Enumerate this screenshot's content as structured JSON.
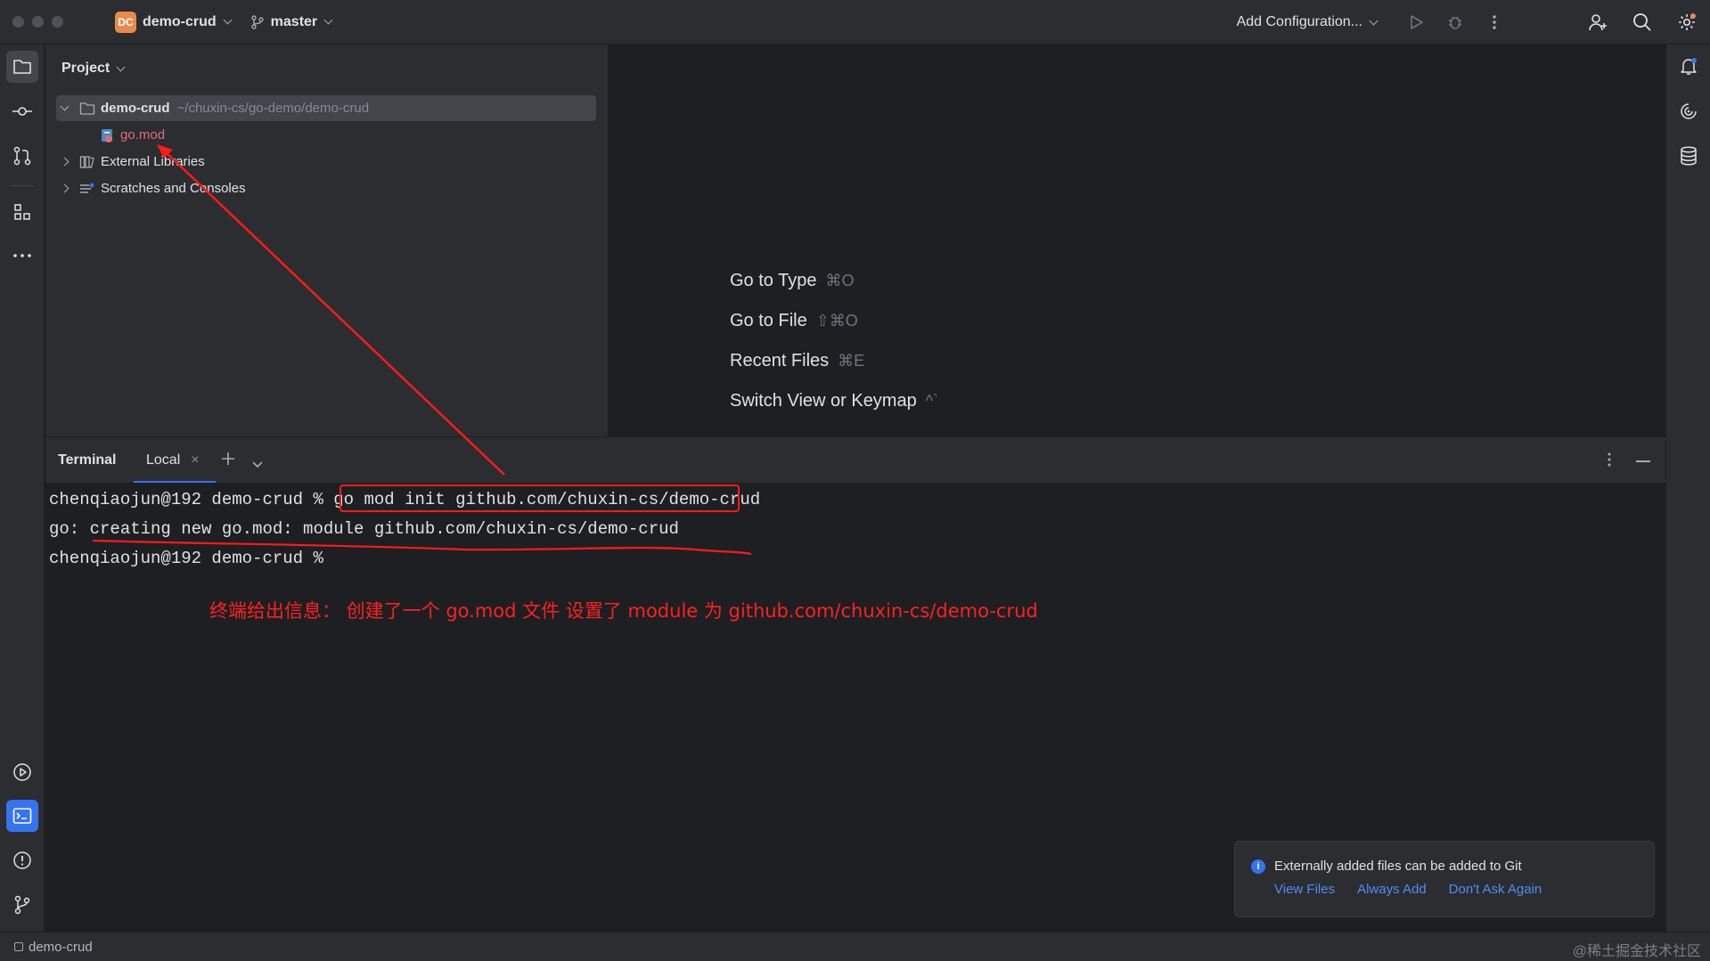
{
  "titlebar": {
    "project_badge": "DC",
    "project_name": "demo-crud",
    "branch": "master",
    "run_config": "Add Configuration..."
  },
  "project_panel": {
    "title": "Project",
    "tree": [
      {
        "name": "demo-crud",
        "path": "~/chuxin-cs/go-demo/demo-crud"
      },
      {
        "name": "go.mod"
      },
      {
        "name": "External Libraries"
      },
      {
        "name": "Scratches and Consoles"
      }
    ]
  },
  "editor": {
    "hints": [
      {
        "label": "Go to Type",
        "shortcut": "⌘O"
      },
      {
        "label": "Go to File",
        "shortcut": "⇧⌘O"
      },
      {
        "label": "Recent Files",
        "shortcut": "⌘E"
      },
      {
        "label": "Switch View or Keymap",
        "shortcut": "^`"
      }
    ]
  },
  "terminal": {
    "title": "Terminal",
    "tab_label": "Local",
    "prompt1": "chenqiaojun@192 demo-crud % ",
    "command": "go mod init github.com/chuxin-cs/demo-crud",
    "output": "go: creating new go.mod: module github.com/chuxin-cs/demo-crud",
    "prompt2": "chenqiaojun@192 demo-crud %",
    "annotation": "终端给出信息：  创建了一个 go.mod 文件  设置了 module 为  github.com/chuxin-cs/demo-crud"
  },
  "notification": {
    "message": "Externally added files can be added to Git",
    "actions": [
      "View Files",
      "Always Add",
      "Don't Ask Again"
    ]
  },
  "statusbar": {
    "breadcrumb": "demo-crud",
    "watermark": "@稀土掘金技术社区"
  },
  "colors": {
    "accent": "#3574f0",
    "annotation_red": "#ff1a1a",
    "project_badge": "#e98a4d"
  }
}
